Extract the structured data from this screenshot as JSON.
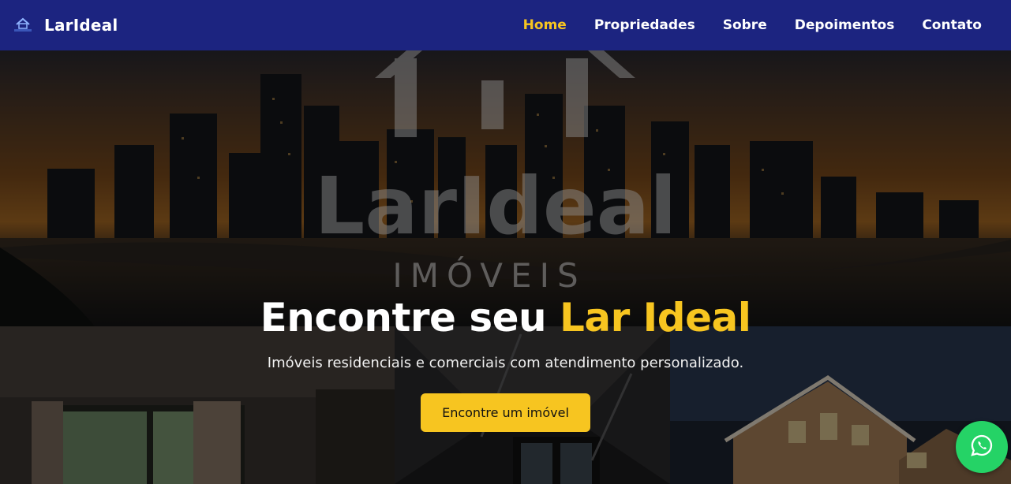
{
  "brand": {
    "name": "LarIdeal",
    "logo_icon": "house-logo-icon"
  },
  "nav": {
    "items": [
      {
        "label": "Home",
        "active": true
      },
      {
        "label": "Propriedades",
        "active": false
      },
      {
        "label": "Sobre",
        "active": false
      },
      {
        "label": "Depoimentos",
        "active": false
      },
      {
        "label": "Contato",
        "active": false
      }
    ]
  },
  "hero": {
    "watermark_title": "LarIdeal",
    "watermark_subtitle": "IMÓVEIS",
    "title_prefix": "Encontre seu ",
    "title_accent": "Lar Ideal",
    "subtitle": "Imóveis residenciais e comerciais com atendimento personalizado.",
    "cta_label": "Encontre um imóvel"
  },
  "floating": {
    "whatsapp_icon": "whatsapp-icon"
  },
  "colors": {
    "navbar_bg": "#1c2480",
    "accent": "#f7c520",
    "whatsapp": "#25d366"
  }
}
